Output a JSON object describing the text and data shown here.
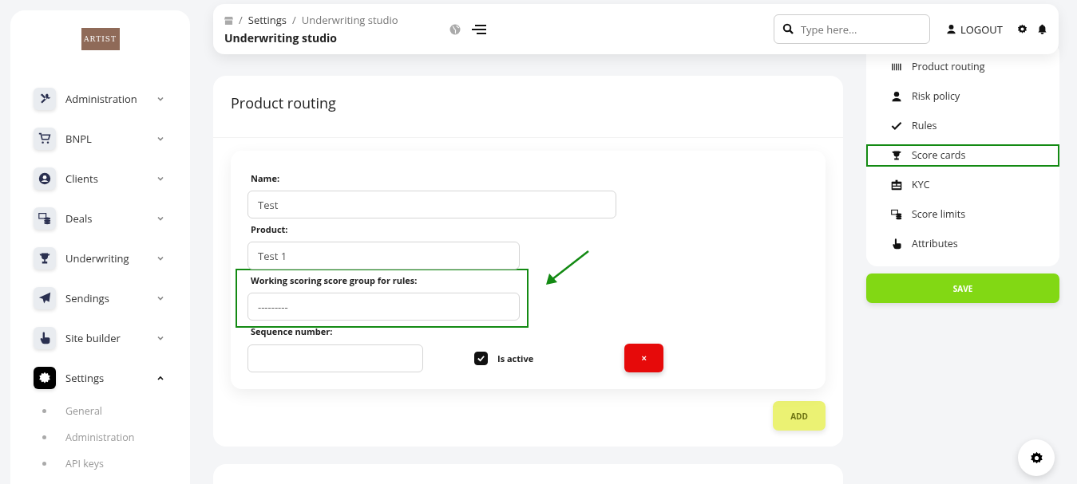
{
  "sidebar": {
    "logo": "ARTIST",
    "items": [
      {
        "label": "Administration",
        "expanded": false,
        "selected": false
      },
      {
        "label": "BNPL",
        "expanded": false,
        "selected": false
      },
      {
        "label": "Clients",
        "expanded": false,
        "selected": false
      },
      {
        "label": "Deals",
        "expanded": false,
        "selected": false
      },
      {
        "label": "Underwriting",
        "expanded": false,
        "selected": false
      },
      {
        "label": "Sendings",
        "expanded": false,
        "selected": false
      },
      {
        "label": "Site builder",
        "expanded": false,
        "selected": false
      },
      {
        "label": "Settings",
        "expanded": true,
        "selected": true,
        "children": [
          {
            "label": "General"
          },
          {
            "label": "Administration"
          },
          {
            "label": "API keys"
          }
        ]
      }
    ]
  },
  "topbar": {
    "breadcrumb": [
      {
        "separator": "/",
        "label": "Settings"
      },
      {
        "separator": "/",
        "label": "Underwriting studio"
      }
    ],
    "title": "Underwriting studio",
    "search": {
      "placeholder": "Type here..."
    },
    "logout": "LOGOUT"
  },
  "card": {
    "title": "Product routing",
    "fields": [
      {
        "label": "Name:",
        "value": "Test",
        "highlighted": false
      },
      {
        "label": "Product:",
        "value": "Test 1",
        "highlighted": false
      },
      {
        "label": "Working scoring score group for rules:",
        "value": "---------",
        "highlighted": true
      }
    ],
    "sequence": {
      "label": "Sequence number:"
    },
    "active": {
      "label": "Is active",
      "checked": true
    },
    "remove_button": "×",
    "add_button": "ADD"
  },
  "right_nav": {
    "items": [
      {
        "label": "Product routing",
        "highlighted": false
      },
      {
        "label": "Risk policy",
        "highlighted": false
      },
      {
        "label": "Rules",
        "highlighted": false
      },
      {
        "label": "Score cards",
        "highlighted": true
      },
      {
        "label": "KYC",
        "highlighted": false
      },
      {
        "label": "Score limits",
        "highlighted": false
      },
      {
        "label": "Attributes",
        "highlighted": false
      }
    ],
    "save": "SAVE"
  }
}
